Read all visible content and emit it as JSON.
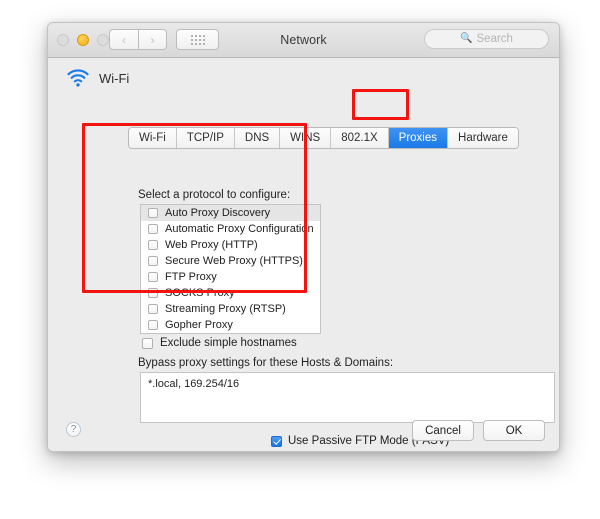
{
  "window": {
    "title": "Network",
    "traffic_lights": [
      {
        "name": "close",
        "state": "disabled"
      },
      {
        "name": "minimize",
        "state": "active",
        "color": "#f6b01e"
      },
      {
        "name": "zoom",
        "state": "disabled"
      }
    ],
    "nav": {
      "back": "‹",
      "forward": "›"
    },
    "show_all_label": "show-all-grid",
    "search": {
      "placeholder": "Search",
      "value": "",
      "icon": "search-icon"
    }
  },
  "service": {
    "name": "Wi-Fi",
    "icon": "wifi-icon",
    "icon_color": "#1a7ae8"
  },
  "tabs": [
    {
      "label": "Wi-Fi",
      "selected": false
    },
    {
      "label": "TCP/IP",
      "selected": false
    },
    {
      "label": "DNS",
      "selected": false
    },
    {
      "label": "WINS",
      "selected": false
    },
    {
      "label": "802.1X",
      "selected": false
    },
    {
      "label": "Proxies",
      "selected": true
    },
    {
      "label": "Hardware",
      "selected": false
    }
  ],
  "proxies": {
    "protocol_label": "Select a protocol to configure:",
    "protocols": [
      {
        "label": "Auto Proxy Discovery",
        "checked": false,
        "highlighted": true
      },
      {
        "label": "Automatic Proxy Configuration",
        "checked": false,
        "highlighted": false
      },
      {
        "label": "Web Proxy (HTTP)",
        "checked": false,
        "highlighted": false
      },
      {
        "label": "Secure Web Proxy (HTTPS)",
        "checked": false,
        "highlighted": false
      },
      {
        "label": "FTP Proxy",
        "checked": false,
        "highlighted": false
      },
      {
        "label": "SOCKS Proxy",
        "checked": false,
        "highlighted": false
      },
      {
        "label": "Streaming Proxy (RTSP)",
        "checked": false,
        "highlighted": false
      },
      {
        "label": "Gopher Proxy",
        "checked": false,
        "highlighted": false
      }
    ],
    "exclude_simple_hostnames": {
      "label": "Exclude simple hostnames",
      "checked": false
    },
    "bypass_label": "Bypass proxy settings for these Hosts & Domains:",
    "bypass_value": "*.local, 169.254/16",
    "passive_ftp": {
      "label": "Use Passive FTP Mode (PASV)",
      "checked": true
    }
  },
  "footer": {
    "help_label": "?",
    "cancel_label": "Cancel",
    "ok_label": "OK"
  },
  "annotations": {
    "color": "#f5130f",
    "protocol_box": "highlight-protocol-section",
    "tab_box": "highlight-proxies-tab"
  }
}
